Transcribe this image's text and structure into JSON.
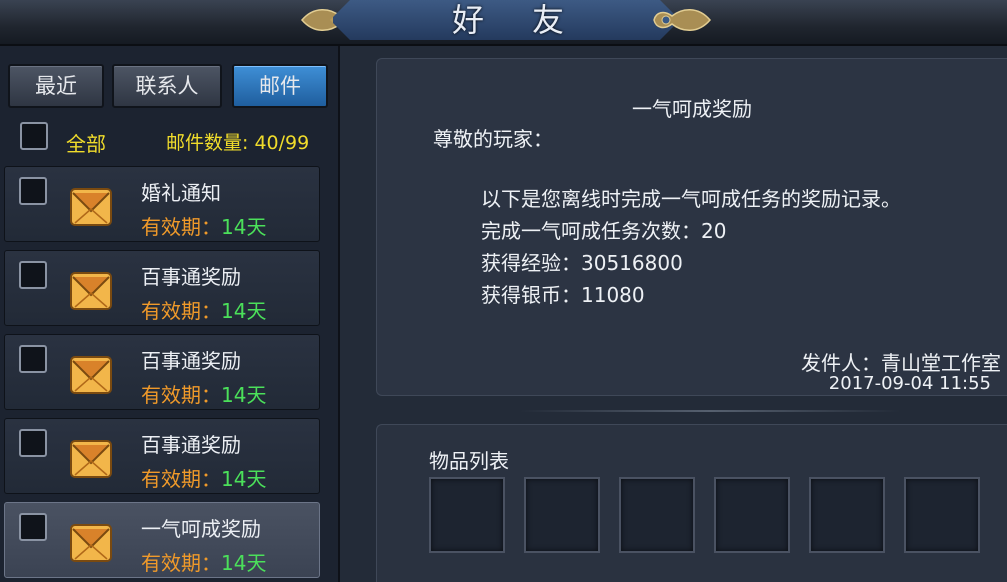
{
  "window": {
    "title": "好友"
  },
  "tabs": [
    {
      "label": "最近"
    },
    {
      "label": "联系人"
    },
    {
      "label": "邮件"
    }
  ],
  "list_header": {
    "all_label": "全部",
    "mail_count": "邮件数量: 40/99"
  },
  "mails": [
    {
      "title": "婚礼通知",
      "validity_label": "有效期：",
      "validity_value": "14天"
    },
    {
      "title": "百事通奖励",
      "validity_label": "有效期：",
      "validity_value": "14天"
    },
    {
      "title": "百事通奖励",
      "validity_label": "有效期：",
      "validity_value": "14天"
    },
    {
      "title": "百事通奖励",
      "validity_label": "有效期：",
      "validity_value": "14天"
    },
    {
      "title": "一气呵成奖励",
      "validity_label": "有效期：",
      "validity_value": "14天"
    }
  ],
  "mail_detail": {
    "heading": "一气呵成奖励",
    "greeting": "尊敬的玩家：",
    "lines": [
      "以下是您离线时完成一气呵成任务的奖励记录。",
      "完成一气呵成任务次数：20",
      "获得经验：30516800",
      "获得银币：11080"
    ],
    "sender": "发件人：青山堂工作室",
    "date": "2017-09-04 11:55"
  },
  "items": {
    "label": "物品列表"
  },
  "colors": {
    "accent_tab": "#2a78c0",
    "count_yellow": "#f0dc2b",
    "validity_orange": "#f09a2a",
    "validity_green": "#4be05a"
  },
  "icons": {
    "mail": "envelope-icon",
    "title_ornament": "dragon-ornament-icon"
  }
}
